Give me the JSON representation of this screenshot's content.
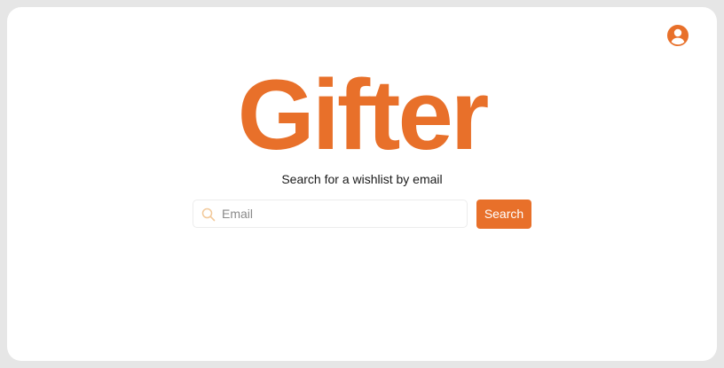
{
  "colors": {
    "brand": "#e8702a",
    "icon_muted": "#f2c99a",
    "window_border": "#e6e6e6"
  },
  "header": {
    "profile_icon": "user-circle-icon"
  },
  "hero": {
    "logo_text": "Gifter",
    "tagline": "Search for a wishlist by email"
  },
  "search": {
    "icon": "search-icon",
    "placeholder": "Email",
    "value": "",
    "button_label": "Search"
  }
}
